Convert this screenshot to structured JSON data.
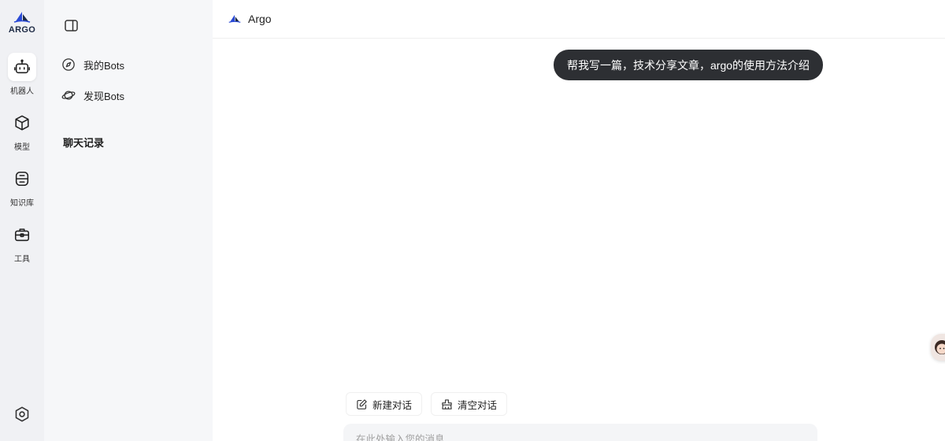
{
  "rail": {
    "logo_text": "ARGO",
    "items": [
      {
        "label": "机器人",
        "icon": "robot-icon",
        "active": true
      },
      {
        "label": "模型",
        "icon": "cube-icon"
      },
      {
        "label": "知识库",
        "icon": "database-icon"
      },
      {
        "label": "工具",
        "icon": "toolbox-icon"
      }
    ],
    "settings_icon": "settings-hexagon-icon"
  },
  "sidebar": {
    "collapse_icon": "sidebar-toggle-icon",
    "items": [
      {
        "label": "我的Bots",
        "icon": "compass-icon"
      },
      {
        "label": "发现Bots",
        "icon": "planet-icon"
      }
    ],
    "history_title": "聊天记录"
  },
  "header": {
    "title": "Argo"
  },
  "chat": {
    "messages": [
      {
        "role": "user",
        "text": "帮我写一篇，技术分享文章，argo的使用方法介绍"
      }
    ]
  },
  "actions": {
    "new_chat": "新建对话",
    "clear_chat": "清空对话"
  },
  "composer": {
    "placeholder": "在此处输入您的消息..."
  },
  "colors": {
    "rail_bg": "#f0f1f4",
    "sidebar_bg": "#f6f7f9",
    "bubble_bg": "#2d2f33",
    "brand_blue": "#2a4ad6"
  }
}
